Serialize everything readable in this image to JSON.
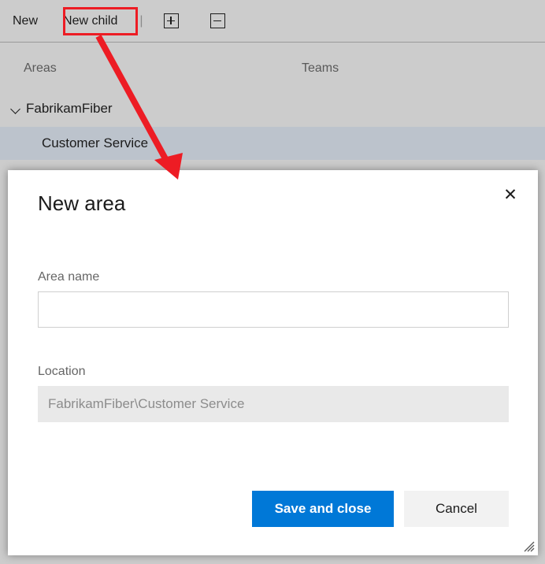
{
  "toolbar": {
    "new_label": "New",
    "new_child_label": "New child",
    "separator": "|",
    "expand_all_icon": "plus-box-icon",
    "collapse_all_icon": "minus-box-icon"
  },
  "columns": {
    "areas_header": "Areas",
    "teams_header": "Teams"
  },
  "tree": {
    "root": {
      "label": "FabrikamFiber",
      "chevron_icon": "chevron-down-icon",
      "expanded": true
    },
    "child": {
      "label": "Customer Service",
      "selected": true
    }
  },
  "dialog": {
    "title": "New area",
    "close_icon": "close-icon",
    "fields": {
      "area_name": {
        "label": "Area name",
        "value": "",
        "placeholder": ""
      },
      "location": {
        "label": "Location",
        "value": "FabrikamFiber\\Customer Service",
        "readonly": true
      }
    },
    "buttons": {
      "save_label": "Save and close",
      "cancel_label": "Cancel"
    },
    "resize_grip_icon": "resize-grip-icon"
  },
  "annotation": {
    "highlight_target": "New child",
    "arrow_icon": "arrow-icon",
    "color": "#ed1c24"
  },
  "colors": {
    "page_background": "#cccccc",
    "selected_row": "#bcc3cc",
    "primary_button": "#0078d7",
    "secondary_button": "#f2f2f2",
    "readonly_field": "#e9e9e9",
    "annotation_red": "#ed1c24"
  }
}
